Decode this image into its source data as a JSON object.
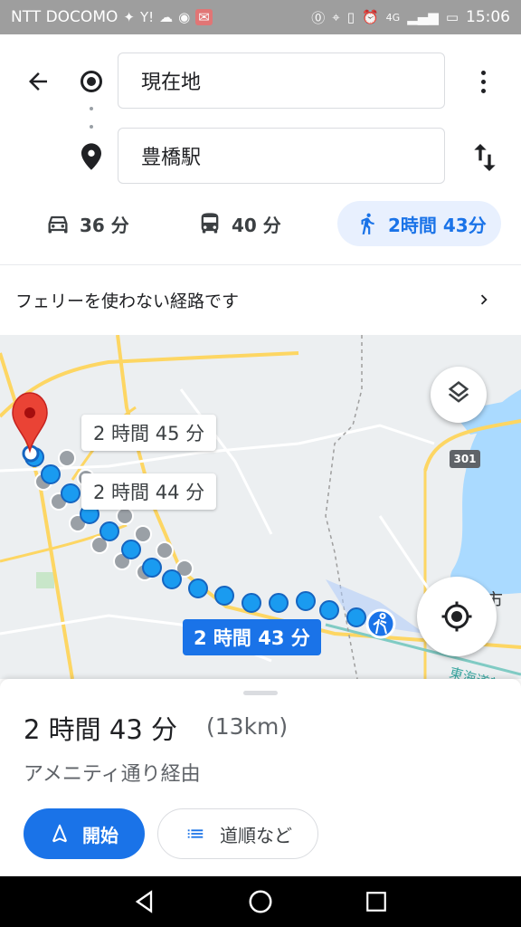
{
  "statusbar": {
    "carrier": "NTT DOCOMO",
    "time": "15:06",
    "network": "4G"
  },
  "header": {
    "origin": "現在地",
    "destination": "豊橋駅"
  },
  "modes": {
    "drive": "36 分",
    "transit": "40 分",
    "walk": "2時間 43分",
    "selected": "walk"
  },
  "ferry_notice": "フェリーを使わない経路です",
  "map": {
    "alt_route_1": "2 時間 45 分",
    "alt_route_2": "2 時間 44 分",
    "main_route": "2 時間 43 分",
    "route_number": "301",
    "city_label": "市",
    "rail_label": "東海道新"
  },
  "summary": {
    "time": "2 時間 43 分",
    "distance": "(13km)",
    "via": "アメニティ通り経由"
  },
  "actions": {
    "start": "開始",
    "steps": "道順など"
  },
  "colors": {
    "accent": "#1a73e8",
    "alt_route": "#9aa0a6",
    "pin": "#ea4335"
  }
}
